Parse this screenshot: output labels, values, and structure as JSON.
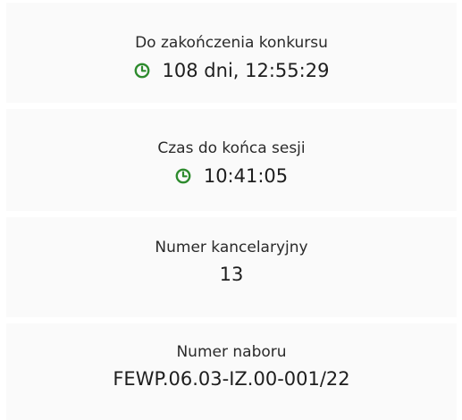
{
  "accent_color": "#2e8b2e",
  "cards": [
    {
      "label": "Do zakończenia konkursu",
      "value": "108 dni, 12:55:29",
      "icon": "clock-icon"
    },
    {
      "label": "Czas do końca sesji",
      "value": "10:41:05",
      "icon": "clock-icon"
    },
    {
      "label": "Numer kancelaryjny",
      "value": "13"
    },
    {
      "label": "Numer naboru",
      "value": "FEWP.06.03-IZ.00-001/22"
    }
  ]
}
